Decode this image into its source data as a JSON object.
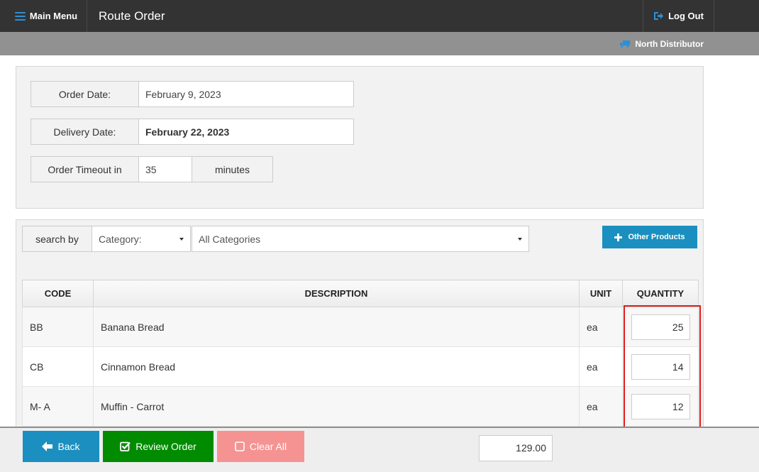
{
  "header": {
    "menu_label": "Main Menu",
    "title": "Route Order",
    "logout_label": "Log Out"
  },
  "subheader": {
    "distributor": "North Distributor"
  },
  "dates": {
    "order_date_label": "Order Date:",
    "order_date_value": "February 9, 2023",
    "delivery_date_label": "Delivery Date:",
    "delivery_date_value": "February 22, 2023",
    "timeout_label": "Order Timeout in",
    "timeout_value": "35",
    "timeout_unit": "minutes"
  },
  "search": {
    "label": "search by",
    "field_selected": "Category:",
    "category_selected": "All Categories",
    "other_products_label": "Other Products"
  },
  "table": {
    "columns": [
      "CODE",
      "DESCRIPTION",
      "UNIT",
      "QUANTITY"
    ],
    "rows": [
      {
        "code": "BB",
        "description": "Banana Bread",
        "unit": "ea",
        "quantity": "25"
      },
      {
        "code": "CB",
        "description": "Cinnamon Bread",
        "unit": "ea",
        "quantity": "14"
      },
      {
        "code": "M- A",
        "description": "Muffin - Carrot",
        "unit": "ea",
        "quantity": "12"
      }
    ]
  },
  "footer": {
    "back_label": "Back",
    "review_label": "Review Order",
    "clear_label": "Clear All",
    "total": "129.00"
  },
  "colors": {
    "topbar": "#333333",
    "subbar": "#919191",
    "primary": "#1b8fbf",
    "success": "#008b00",
    "danger_light": "#f59393",
    "highlight": "#e01b1b"
  }
}
